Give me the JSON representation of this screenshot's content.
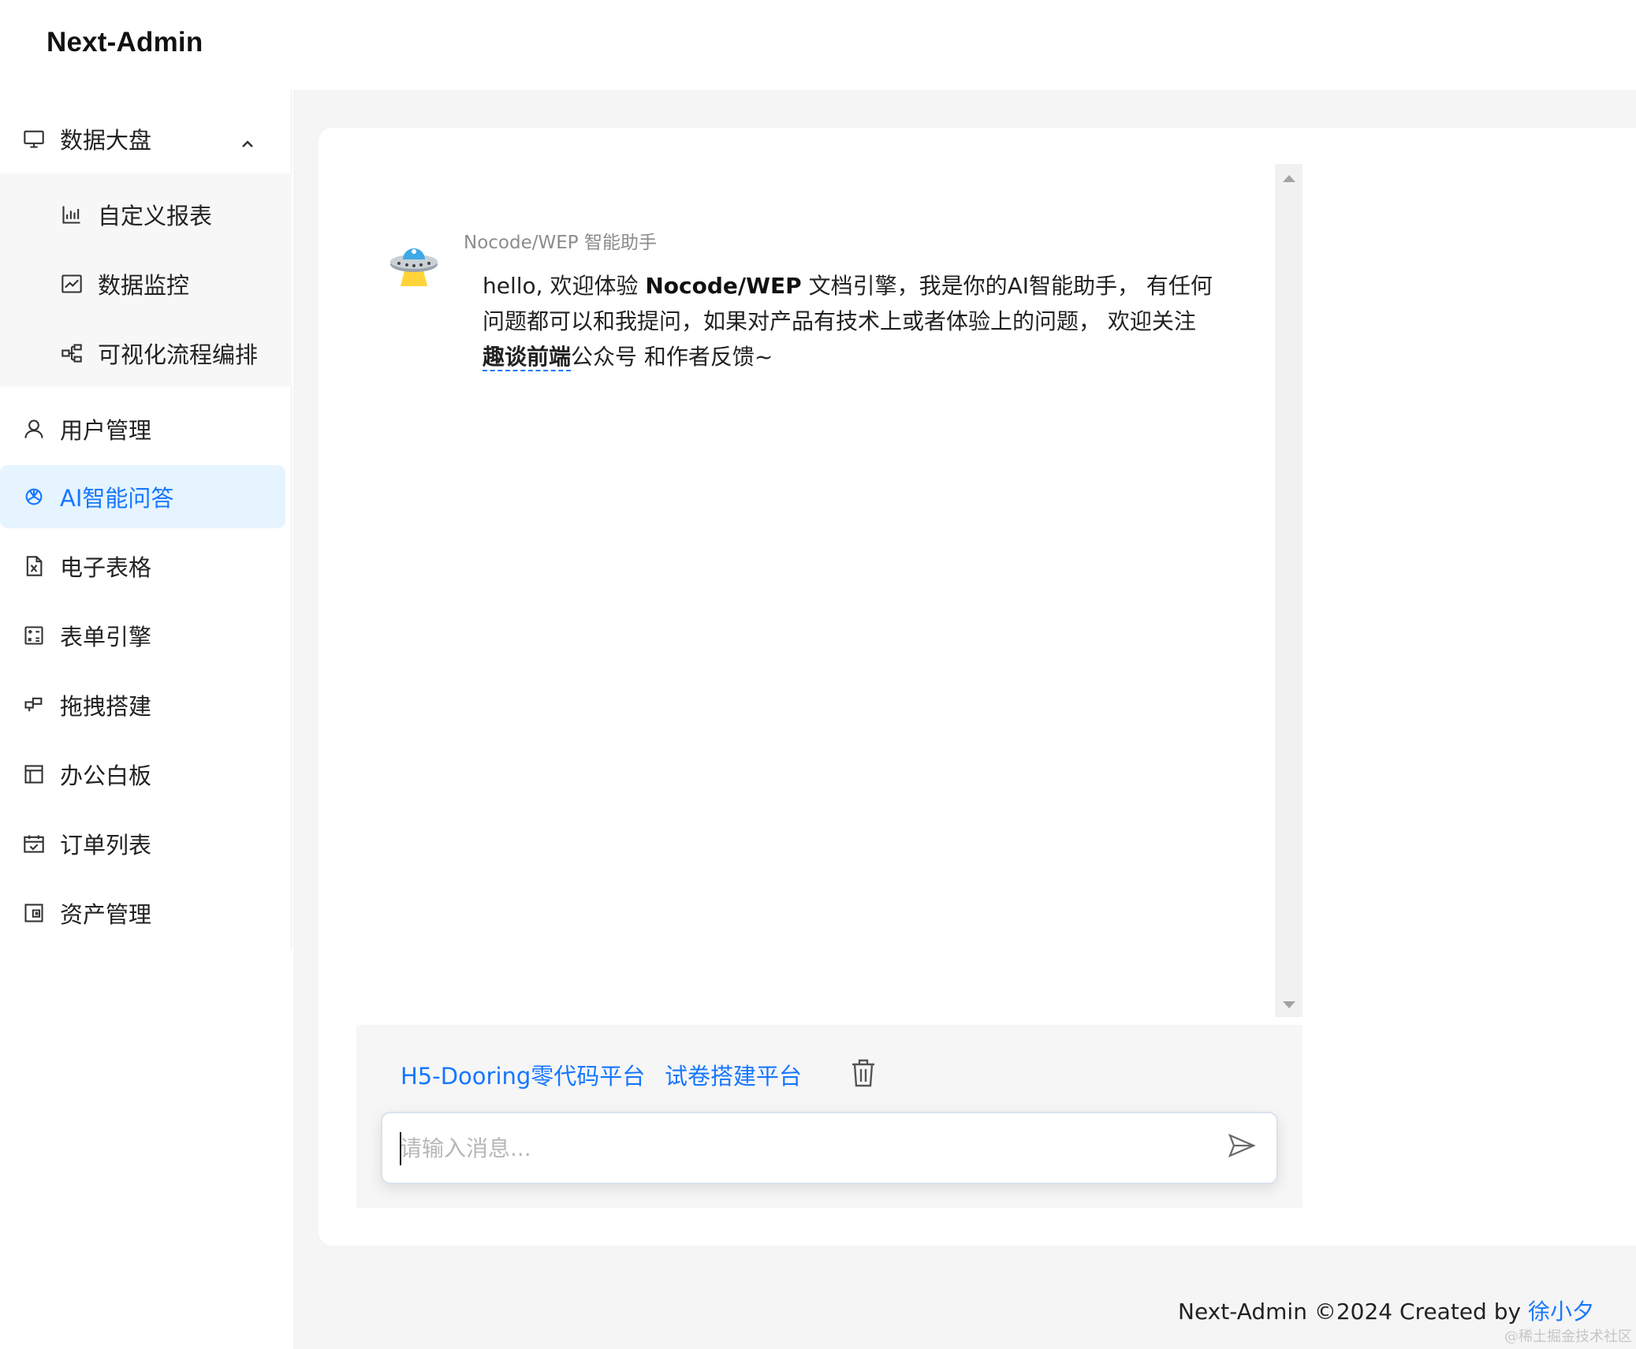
{
  "app": {
    "brand": "Next-Admin"
  },
  "sidebar": {
    "groups": [
      {
        "label": "数据大盘",
        "icon": "monitor-icon",
        "expanded": true,
        "children": [
          {
            "label": "自定义报表",
            "icon": "bar-chart-icon"
          },
          {
            "label": "数据监控",
            "icon": "line-chart-icon"
          },
          {
            "label": "可视化流程编排",
            "icon": "flow-icon"
          }
        ]
      }
    ],
    "items": [
      {
        "label": "用户管理",
        "icon": "user-icon"
      },
      {
        "label": "AI智能问答",
        "icon": "openai-icon",
        "active": true
      },
      {
        "label": "电子表格",
        "icon": "excel-file-icon"
      },
      {
        "label": "表单引擎",
        "icon": "calculator-icon"
      },
      {
        "label": "拖拽搭建",
        "icon": "blocks-icon"
      },
      {
        "label": "办公白板",
        "icon": "layout-icon"
      },
      {
        "label": "订单列表",
        "icon": "calendar-check-icon"
      },
      {
        "label": "资产管理",
        "icon": "wallet-icon"
      }
    ]
  },
  "chat": {
    "bot_name": "Nocode/WEP 智能助手",
    "avatar_icon": "ufo-icon",
    "message": {
      "p1": "hello, 欢迎体验 ",
      "b1": "Nocode/WEP",
      "p2": " 文档引擎，我是你的AI智能助手， 有任何问题都可以和我提问，如果对产品有技术上或者体验上的问题， 欢迎关注 ",
      "b2": "趣谈前端",
      "p3": "公众号 和作者反馈~"
    },
    "quick_links": [
      "H5-Dooring零代码平台",
      "试卷搭建平台"
    ],
    "clear_icon": "trash-icon",
    "input": {
      "value": "",
      "placeholder": "请输入消息..."
    },
    "send_icon": "send-icon"
  },
  "footer": {
    "text": "Next-Admin ©2024 Created by ",
    "author": "徐小夕"
  },
  "watermark": "@稀土掘金技术社区",
  "colors": {
    "accent": "#1677ff",
    "active_bg": "#e6f4ff",
    "page_bg": "#f5f5f5"
  }
}
